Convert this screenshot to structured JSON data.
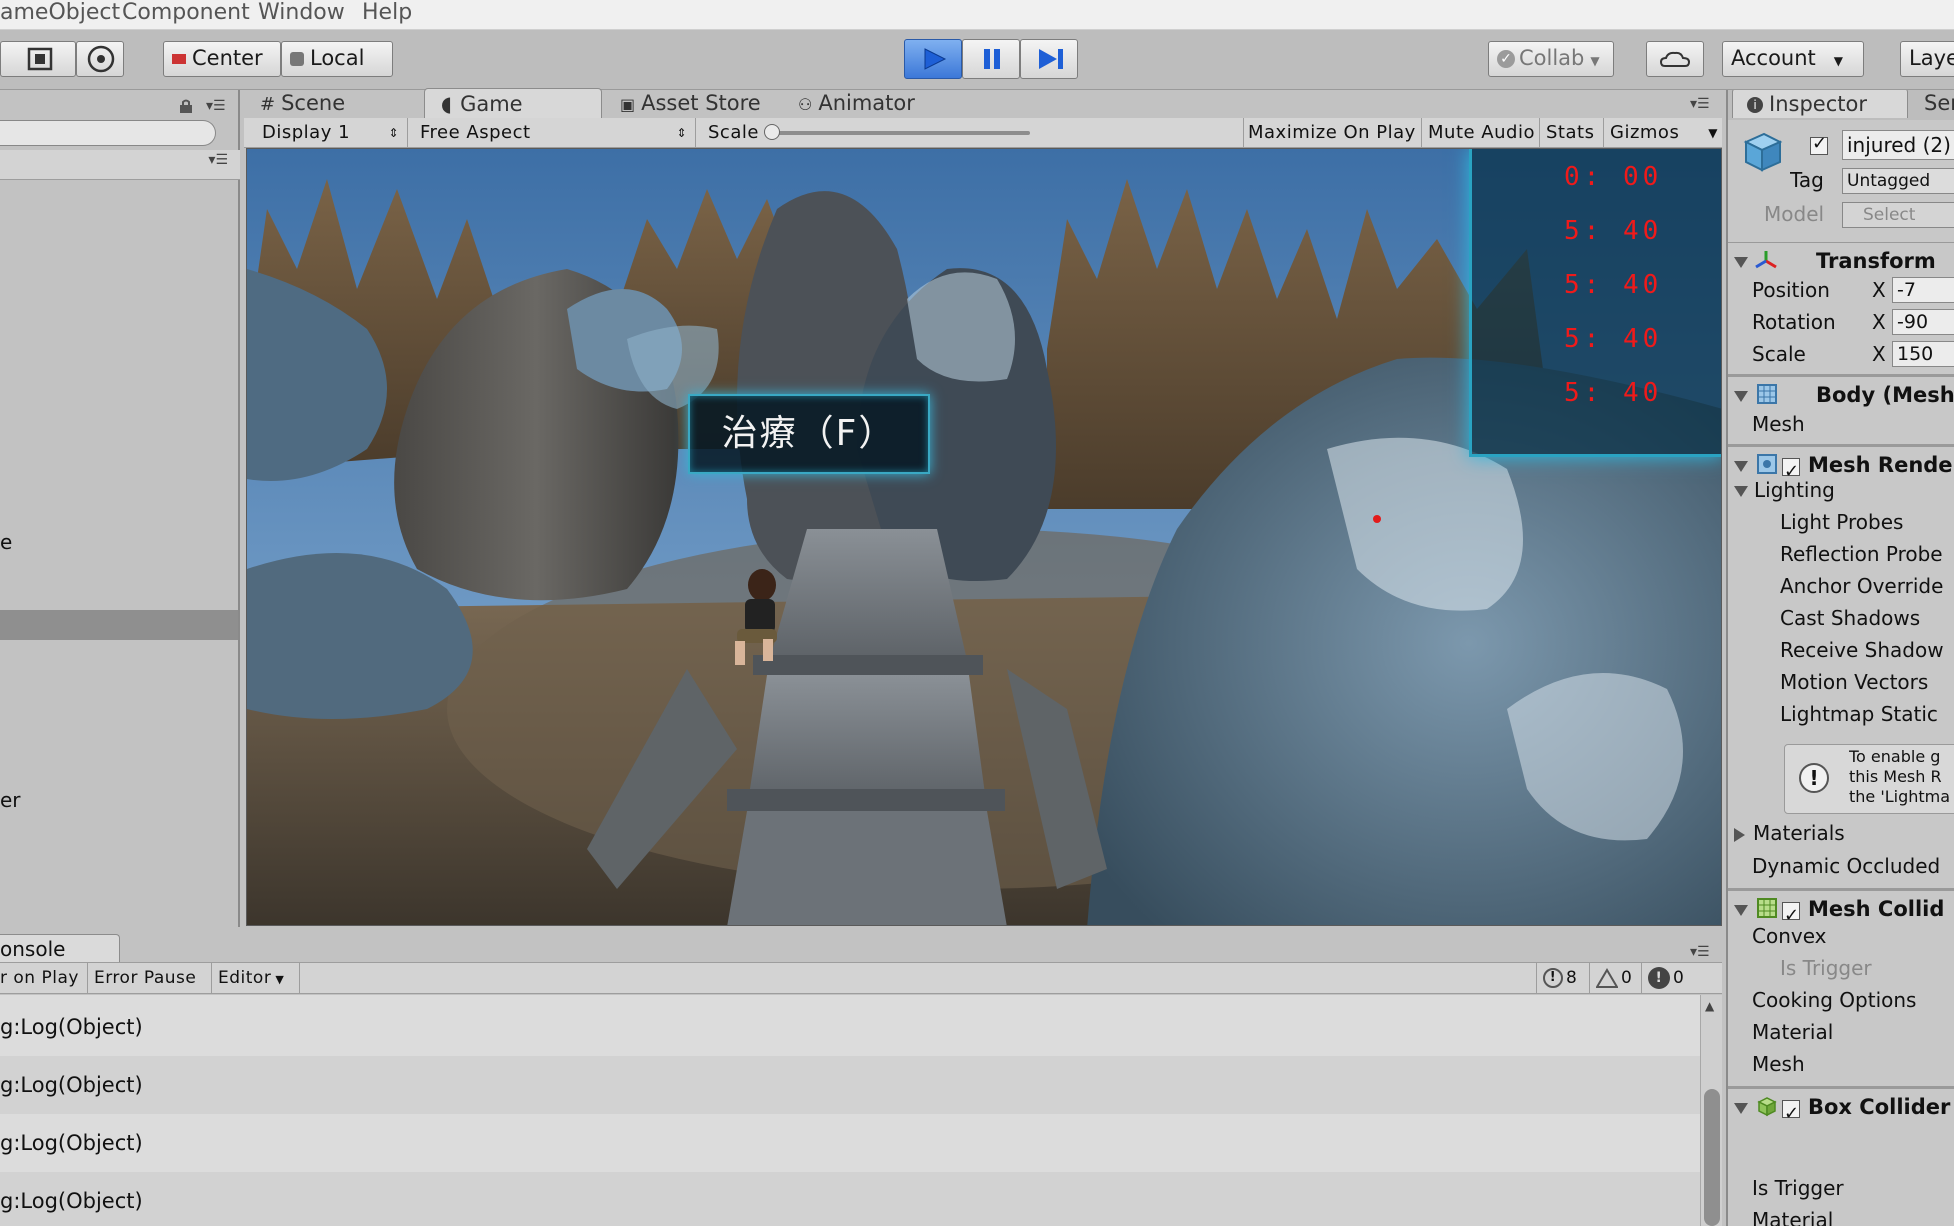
{
  "menubar": {
    "items": [
      "ameObject",
      "Component",
      "Window",
      "Help"
    ]
  },
  "toolbar": {
    "center_label": "Center",
    "local_label": "Local",
    "collab_label": "Collab",
    "account_label": "Account",
    "layers_label": "Laye"
  },
  "tabs": {
    "scene": "Scene",
    "game": "Game",
    "asset_store": "Asset Store",
    "animator": "Animator",
    "inspector": "Inspector",
    "services": "Ser"
  },
  "gamebar": {
    "display": "Display 1",
    "aspect": "Free Aspect",
    "scale_label": "Scale",
    "scale_value": "1x",
    "maximize": "Maximize On Play",
    "mute": "Mute Audio",
    "stats": "Stats",
    "gizmos": "Gizmos"
  },
  "hierarchy": {
    "partial_e": "e",
    "partial_er": "er"
  },
  "game_hud": {
    "heal_prompt": "治療（F）",
    "timers": [
      "0: 00",
      "5: 40",
      "5: 40",
      "5: 40",
      "5: 40"
    ]
  },
  "console": {
    "tab_label": "onsole",
    "clear_on_play": "r on Play",
    "error_pause": "Error Pause",
    "editor": "Editor",
    "count_logs": "8",
    "count_warnings": "0",
    "count_errors": "0",
    "rows": [
      "g:Log(Object)",
      "g:Log(Object)",
      "g:Log(Object)",
      "g:Log(Object)"
    ]
  },
  "inspector": {
    "object_name": "injured (2)",
    "tag_label": "Tag",
    "tag_value": "Untagged",
    "model_label": "Model",
    "select_label": "Select",
    "transform": {
      "title": "Transform",
      "position_label": "Position",
      "rotation_label": "Rotation",
      "scale_label": "Scale",
      "axis_x": "X",
      "position_x": "-7",
      "rotation_x": "-90",
      "scale_x": "150"
    },
    "body_mesh": {
      "title": "Body (Mesh",
      "mesh_label": "Mesh"
    },
    "mesh_renderer": {
      "title": "Mesh Rende",
      "lighting": "Lighting",
      "light_probes": "Light Probes",
      "reflection_probes": "Reflection Probe",
      "anchor_override": "Anchor Override",
      "cast_shadows": "Cast Shadows",
      "receive_shadows": "Receive Shadow",
      "motion_vectors": "Motion Vectors",
      "lightmap_static": "Lightmap Static",
      "info_line1": "To enable g",
      "info_line2": "this Mesh R",
      "info_line3": "the 'Lightma",
      "materials": "Materials",
      "dynamic_occluded": "Dynamic Occluded"
    },
    "mesh_collider": {
      "title": "Mesh Collid",
      "convex": "Convex",
      "is_trigger": "Is Trigger",
      "cooking_options": "Cooking Options",
      "material": "Material",
      "mesh": "Mesh"
    },
    "box_collider": {
      "title": "Box Collider",
      "is_trigger": "Is Trigger",
      "material": "Material"
    }
  }
}
